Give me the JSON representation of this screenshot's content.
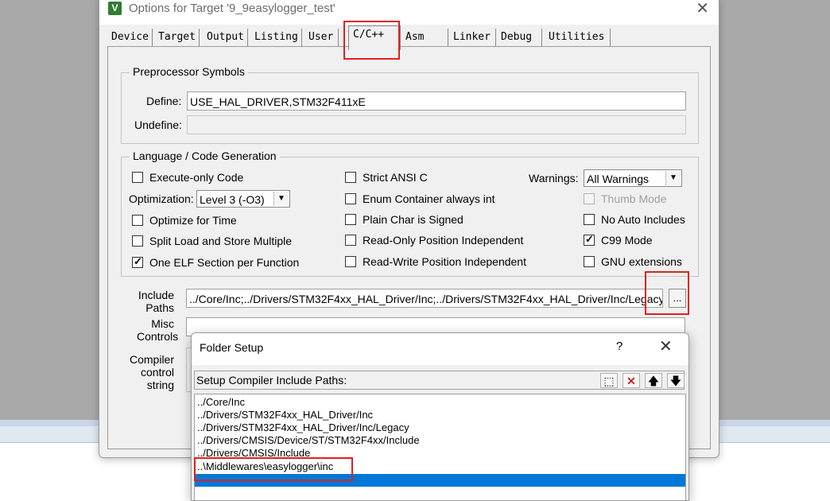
{
  "window": {
    "title": "Options for Target '9_9easylogger_test'",
    "app_icon_glyph": "V",
    "close_glyph": "✕"
  },
  "tabs": [
    {
      "label": "Device"
    },
    {
      "label": "Target"
    },
    {
      "label": "Output"
    },
    {
      "label": "Listing"
    },
    {
      "label": "User"
    },
    {
      "label": "C/C++",
      "active": true
    },
    {
      "label": "Asm"
    },
    {
      "label": "Linker"
    },
    {
      "label": "Debug"
    },
    {
      "label": "Utilities"
    }
  ],
  "preprocessor": {
    "group_label": "Preprocessor Symbols",
    "define_label": "Define:",
    "define_value": "USE_HAL_DRIVER,STM32F411xE",
    "undefine_label": "Undefine:",
    "undefine_value": ""
  },
  "language": {
    "group_label": "Language / Code Generation",
    "execute_only": {
      "label": "Execute-only Code",
      "checked": false
    },
    "optimization_label": "Optimization:",
    "optimization_value": "Level 3 (-O3)",
    "optimize_time": {
      "label": "Optimize for Time",
      "checked": false
    },
    "split_load": {
      "label": "Split Load and Store Multiple",
      "checked": false
    },
    "one_elf": {
      "label": "One ELF Section per Function",
      "checked": true
    },
    "strict_ansi": {
      "label": "Strict ANSI C",
      "checked": false
    },
    "enum_int": {
      "label": "Enum Container always int",
      "checked": false
    },
    "plain_char": {
      "label": "Plain Char is Signed",
      "checked": false
    },
    "ro_pi": {
      "label": "Read-Only Position Independent",
      "checked": false
    },
    "rw_pi": {
      "label": "Read-Write Position Independent",
      "checked": false
    },
    "warnings_label": "Warnings:",
    "warnings_value": "All Warnings",
    "thumb_mode": {
      "label": "Thumb Mode",
      "checked": false,
      "disabled": true
    },
    "no_auto_includes": {
      "label": "No Auto Includes",
      "checked": false
    },
    "c99_mode": {
      "label": "C99 Mode",
      "checked": true
    },
    "gnu_ext": {
      "label": "GNU extensions",
      "checked": false
    }
  },
  "paths": {
    "include_label_1": "Include",
    "include_label_2": "Paths",
    "include_value": "../Core/Inc;../Drivers/STM32F4xx_HAL_Driver/Inc;../Drivers/STM32F4xx_HAL_Driver/Inc/Legacy;",
    "browse_label": "...",
    "misc_label_1": "Misc",
    "misc_label_2": "Controls",
    "compiler_label_1": "Compiler",
    "compiler_label_2": "control",
    "compiler_label_3": "string"
  },
  "folder_setup": {
    "title": "Folder Setup",
    "help_glyph": "?",
    "close_glyph": "✕",
    "header_label": "Setup Compiler Include Paths:",
    "toolbar": {
      "new_glyph": "⬚",
      "delete_glyph": "✕",
      "up_glyph": "🡅",
      "down_glyph": "🡇"
    },
    "items": [
      "../Core/Inc",
      "../Drivers/STM32F4xx_HAL_Driver/Inc",
      "../Drivers/STM32F4xx_HAL_Driver/Inc/Legacy",
      "../Drivers/CMSIS/Device/ST/STM32F4xx/Include",
      "../Drivers/CMSIS/Include",
      "..\\Middlewares\\easylogger\\inc",
      ""
    ]
  },
  "colors": {
    "highlight_red": "#e02020",
    "selection_blue": "#0078d7"
  }
}
